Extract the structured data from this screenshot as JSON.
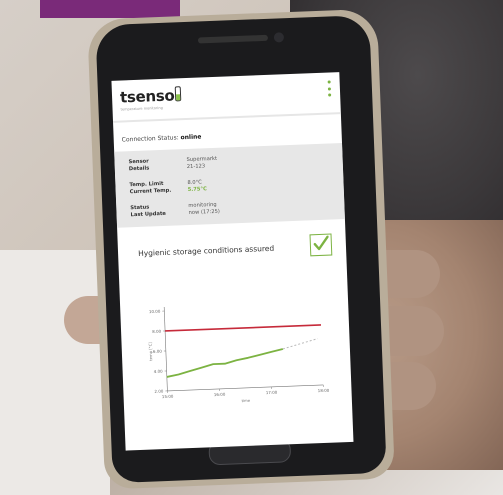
{
  "app": {
    "logo_text": "tsenso",
    "logo_subtitle": "temperature monitoring",
    "accent_color": "#7cb342",
    "limit_color": "#c62a3a"
  },
  "connection": {
    "label": "Connection Status:",
    "value": "online"
  },
  "sensor": {
    "sensor_label": "Sensor",
    "details_label": "Details",
    "sensor_value": "Supermarkt",
    "details_value": "21-123",
    "limit_label": "Temp. Limit",
    "current_label": "Current Temp.",
    "limit_value": "8.0°C",
    "current_value": "5.75°C",
    "status_label": "Status",
    "update_label": "Last Update",
    "status_value": "monitoring",
    "update_value": "now (17:25)"
  },
  "hygiene": {
    "message": "Hygienic storage conditions assured",
    "checked": true
  },
  "chart_data": {
    "type": "line",
    "ylabel": "temp [°C]",
    "xlabel": "time",
    "y_ticks": [
      "10.00",
      "8.00",
      "6.00",
      "4.00",
      "2.00"
    ],
    "x_ticks": [
      "15:00",
      "16:00",
      "17:00",
      "18:00"
    ],
    "ylim": [
      2,
      10
    ],
    "xlim": [
      0,
      4
    ],
    "limit": 8.0,
    "series": [
      {
        "x": [
          0.0,
          0.3,
          0.6,
          0.9,
          1.2,
          1.5,
          1.8,
          2.1,
          2.4,
          2.7,
          3.0
        ],
        "y": [
          3.4,
          3.6,
          3.9,
          4.2,
          4.5,
          4.5,
          4.8,
          5.0,
          5.25,
          5.5,
          5.75
        ]
      }
    ],
    "forecast": {
      "x": [
        3.0,
        3.3,
        3.6,
        3.9
      ],
      "y": [
        5.75,
        6.05,
        6.35,
        6.65
      ]
    }
  }
}
